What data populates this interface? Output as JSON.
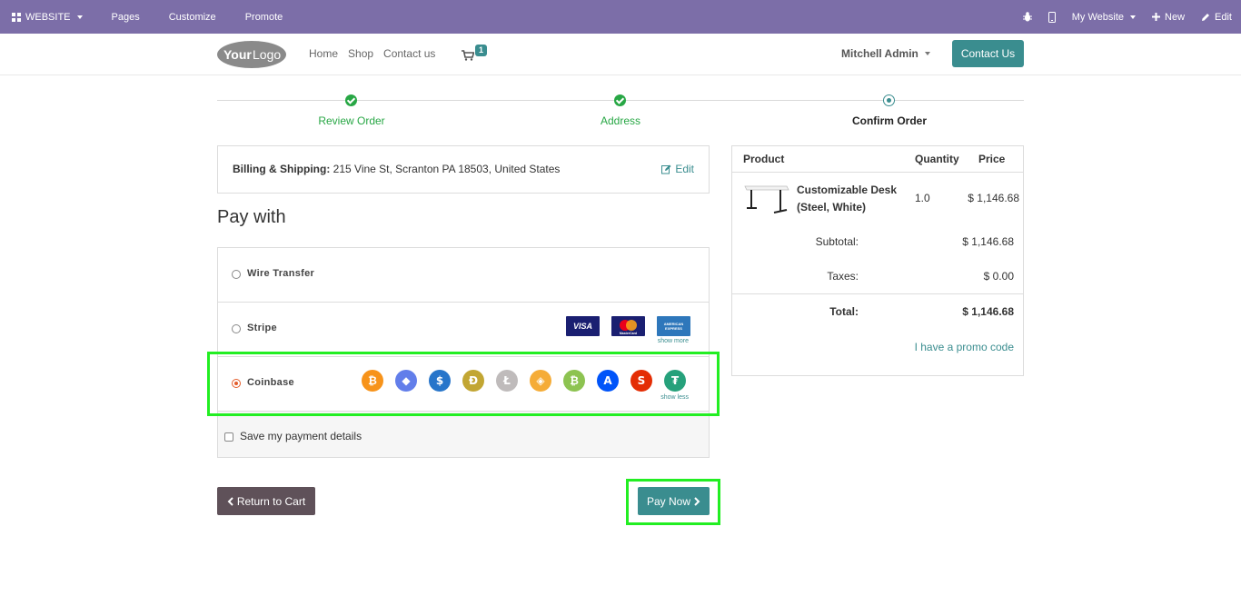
{
  "adminbar": {
    "website": "WEBSITE",
    "pages": "Pages",
    "customize": "Customize",
    "promote": "Promote",
    "my_website": "My Website",
    "new": "New",
    "edit": "Edit"
  },
  "header": {
    "logo_text_a": "Your",
    "logo_text_b": "Logo",
    "nav": [
      "Home",
      "Shop",
      "Contact us"
    ],
    "cart_count": "1",
    "user": "Mitchell Admin",
    "contact_button": "Contact Us"
  },
  "progress": {
    "steps": [
      {
        "label": "Review Order",
        "state": "done"
      },
      {
        "label": "Address",
        "state": "done"
      },
      {
        "label": "Confirm Order",
        "state": "current"
      }
    ]
  },
  "billing": {
    "label": "Billing & Shipping:",
    "address": "215 Vine St, Scranton PA 18503, United States",
    "edit": "Edit"
  },
  "payment": {
    "heading": "Pay with",
    "methods": [
      {
        "name": "Wire Transfer",
        "selected": false
      },
      {
        "name": "Stripe",
        "selected": false,
        "cards": [
          "VISA",
          "MasterCard",
          "AMERICAN EXPRESS"
        ],
        "more": "show more"
      },
      {
        "name": "Coinbase",
        "selected": true,
        "more": "show less",
        "coins": [
          {
            "icon": "bitcoin-icon",
            "glyph": "₿",
            "color": "#f7931a"
          },
          {
            "icon": "ethereum-icon",
            "glyph": "◆",
            "color": "#627eea"
          },
          {
            "icon": "usdc-icon",
            "glyph": "$",
            "color": "#2775ca"
          },
          {
            "icon": "dogecoin-icon",
            "glyph": "Ð",
            "color": "#c2a633"
          },
          {
            "icon": "litecoin-icon",
            "glyph": "Ł",
            "color": "#bfbbbb"
          },
          {
            "icon": "dai-icon",
            "glyph": "◈",
            "color": "#f5ac37"
          },
          {
            "icon": "bitcoin-cash-icon",
            "glyph": "₿",
            "color": "#8dc351"
          },
          {
            "icon": "apecoin-icon",
            "glyph": "A",
            "color": "#0054f9"
          },
          {
            "icon": "shiba-inu-icon",
            "glyph": "S",
            "color": "#e42d04"
          },
          {
            "icon": "tether-icon",
            "glyph": "₮",
            "color": "#26a17b"
          }
        ]
      }
    ],
    "save_details": "Save my payment details"
  },
  "actions": {
    "return": "Return to Cart",
    "pay": "Pay Now"
  },
  "summary": {
    "headers": {
      "product": "Product",
      "quantity": "Quantity",
      "price": "Price"
    },
    "item": {
      "name": "Customizable Desk (Steel, White)",
      "quantity": "1.0",
      "price": "$ 1,146.68"
    },
    "subtotal_label": "Subtotal:",
    "subtotal": "$ 1,146.68",
    "taxes_label": "Taxes:",
    "taxes": "$ 0.00",
    "total_label": "Total:",
    "total": "$ 1,146.68",
    "promo": "I have a promo code"
  },
  "colors": {
    "admin_bar": "#7c6ea8",
    "primary": "#3a8d8f",
    "success": "#28a745",
    "highlight": "#22ee22"
  }
}
